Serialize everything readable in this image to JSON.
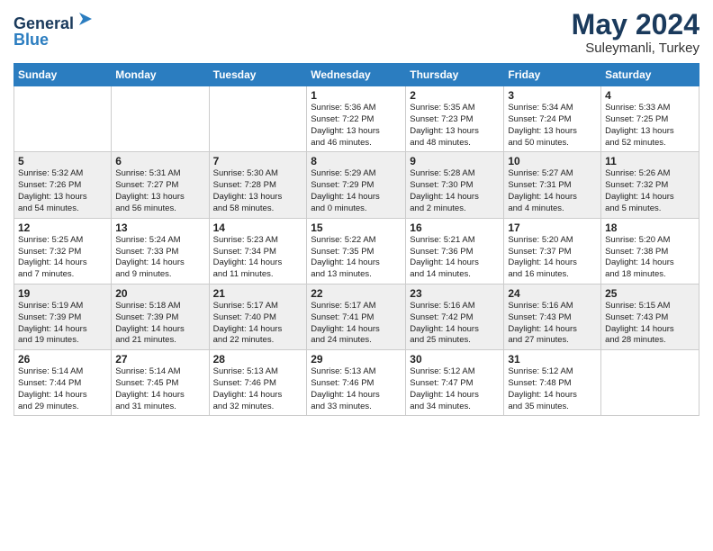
{
  "header": {
    "logo_line1": "General",
    "logo_line2": "Blue",
    "month": "May 2024",
    "location": "Suleymanli, Turkey"
  },
  "weekdays": [
    "Sunday",
    "Monday",
    "Tuesday",
    "Wednesday",
    "Thursday",
    "Friday",
    "Saturday"
  ],
  "weeks": [
    [
      {
        "day": "",
        "info": ""
      },
      {
        "day": "",
        "info": ""
      },
      {
        "day": "",
        "info": ""
      },
      {
        "day": "1",
        "info": "Sunrise: 5:36 AM\nSunset: 7:22 PM\nDaylight: 13 hours\nand 46 minutes."
      },
      {
        "day": "2",
        "info": "Sunrise: 5:35 AM\nSunset: 7:23 PM\nDaylight: 13 hours\nand 48 minutes."
      },
      {
        "day": "3",
        "info": "Sunrise: 5:34 AM\nSunset: 7:24 PM\nDaylight: 13 hours\nand 50 minutes."
      },
      {
        "day": "4",
        "info": "Sunrise: 5:33 AM\nSunset: 7:25 PM\nDaylight: 13 hours\nand 52 minutes."
      }
    ],
    [
      {
        "day": "5",
        "info": "Sunrise: 5:32 AM\nSunset: 7:26 PM\nDaylight: 13 hours\nand 54 minutes."
      },
      {
        "day": "6",
        "info": "Sunrise: 5:31 AM\nSunset: 7:27 PM\nDaylight: 13 hours\nand 56 minutes."
      },
      {
        "day": "7",
        "info": "Sunrise: 5:30 AM\nSunset: 7:28 PM\nDaylight: 13 hours\nand 58 minutes."
      },
      {
        "day": "8",
        "info": "Sunrise: 5:29 AM\nSunset: 7:29 PM\nDaylight: 14 hours\nand 0 minutes."
      },
      {
        "day": "9",
        "info": "Sunrise: 5:28 AM\nSunset: 7:30 PM\nDaylight: 14 hours\nand 2 minutes."
      },
      {
        "day": "10",
        "info": "Sunrise: 5:27 AM\nSunset: 7:31 PM\nDaylight: 14 hours\nand 4 minutes."
      },
      {
        "day": "11",
        "info": "Sunrise: 5:26 AM\nSunset: 7:32 PM\nDaylight: 14 hours\nand 5 minutes."
      }
    ],
    [
      {
        "day": "12",
        "info": "Sunrise: 5:25 AM\nSunset: 7:32 PM\nDaylight: 14 hours\nand 7 minutes."
      },
      {
        "day": "13",
        "info": "Sunrise: 5:24 AM\nSunset: 7:33 PM\nDaylight: 14 hours\nand 9 minutes."
      },
      {
        "day": "14",
        "info": "Sunrise: 5:23 AM\nSunset: 7:34 PM\nDaylight: 14 hours\nand 11 minutes."
      },
      {
        "day": "15",
        "info": "Sunrise: 5:22 AM\nSunset: 7:35 PM\nDaylight: 14 hours\nand 13 minutes."
      },
      {
        "day": "16",
        "info": "Sunrise: 5:21 AM\nSunset: 7:36 PM\nDaylight: 14 hours\nand 14 minutes."
      },
      {
        "day": "17",
        "info": "Sunrise: 5:20 AM\nSunset: 7:37 PM\nDaylight: 14 hours\nand 16 minutes."
      },
      {
        "day": "18",
        "info": "Sunrise: 5:20 AM\nSunset: 7:38 PM\nDaylight: 14 hours\nand 18 minutes."
      }
    ],
    [
      {
        "day": "19",
        "info": "Sunrise: 5:19 AM\nSunset: 7:39 PM\nDaylight: 14 hours\nand 19 minutes."
      },
      {
        "day": "20",
        "info": "Sunrise: 5:18 AM\nSunset: 7:39 PM\nDaylight: 14 hours\nand 21 minutes."
      },
      {
        "day": "21",
        "info": "Sunrise: 5:17 AM\nSunset: 7:40 PM\nDaylight: 14 hours\nand 22 minutes."
      },
      {
        "day": "22",
        "info": "Sunrise: 5:17 AM\nSunset: 7:41 PM\nDaylight: 14 hours\nand 24 minutes."
      },
      {
        "day": "23",
        "info": "Sunrise: 5:16 AM\nSunset: 7:42 PM\nDaylight: 14 hours\nand 25 minutes."
      },
      {
        "day": "24",
        "info": "Sunrise: 5:16 AM\nSunset: 7:43 PM\nDaylight: 14 hours\nand 27 minutes."
      },
      {
        "day": "25",
        "info": "Sunrise: 5:15 AM\nSunset: 7:43 PM\nDaylight: 14 hours\nand 28 minutes."
      }
    ],
    [
      {
        "day": "26",
        "info": "Sunrise: 5:14 AM\nSunset: 7:44 PM\nDaylight: 14 hours\nand 29 minutes."
      },
      {
        "day": "27",
        "info": "Sunrise: 5:14 AM\nSunset: 7:45 PM\nDaylight: 14 hours\nand 31 minutes."
      },
      {
        "day": "28",
        "info": "Sunrise: 5:13 AM\nSunset: 7:46 PM\nDaylight: 14 hours\nand 32 minutes."
      },
      {
        "day": "29",
        "info": "Sunrise: 5:13 AM\nSunset: 7:46 PM\nDaylight: 14 hours\nand 33 minutes."
      },
      {
        "day": "30",
        "info": "Sunrise: 5:12 AM\nSunset: 7:47 PM\nDaylight: 14 hours\nand 34 minutes."
      },
      {
        "day": "31",
        "info": "Sunrise: 5:12 AM\nSunset: 7:48 PM\nDaylight: 14 hours\nand 35 minutes."
      },
      {
        "day": "",
        "info": ""
      }
    ]
  ]
}
